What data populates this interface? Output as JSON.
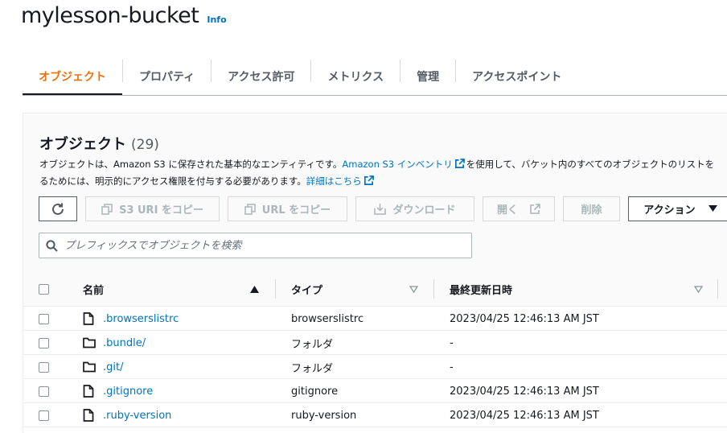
{
  "bucket": {
    "title": "mylesson-bucket",
    "info_label": "Info"
  },
  "tabs": [
    {
      "label": "オブジェクト"
    },
    {
      "label": "プロパティ"
    },
    {
      "label": "アクセス許可"
    },
    {
      "label": "メトリクス"
    },
    {
      "label": "管理"
    },
    {
      "label": "アクセスポイント"
    }
  ],
  "objects_panel": {
    "title": "オブジェクト",
    "count": "(29)",
    "description": {
      "part1": "オブジェクトは、Amazon S3 に保存された基本的なエンティティです。",
      "link1": "Amazon S3 インベントリ",
      "part2": "を使用して、バケット内のすべてのオブジェクトのリストを",
      "part3": "るためには、明示的にアクセス権限を付与する必要があります。",
      "link2": "詳細はこちら"
    }
  },
  "toolbar": {
    "copy_s3_uri": "S3 URI をコピー",
    "copy_url": "URL をコピー",
    "download": "ダウンロード",
    "open": "開く",
    "delete": "削除",
    "actions": "アクション"
  },
  "search": {
    "placeholder": "プレフィックスでオブジェクトを検索"
  },
  "table": {
    "headers": {
      "name": "名前",
      "type": "タイプ",
      "modified": "最終更新日時"
    },
    "rows": [
      {
        "name": ".browserslistrc",
        "type": "browserslistrc",
        "modified": "2023/04/25 12:46:13 AM JST",
        "icon": "file-icon"
      },
      {
        "name": ".bundle/",
        "type": "フォルダ",
        "modified": "-",
        "icon": "folder-icon"
      },
      {
        "name": ".git/",
        "type": "フォルダ",
        "modified": "-",
        "icon": "folder-icon"
      },
      {
        "name": ".gitignore",
        "type": "gitignore",
        "modified": "2023/04/25 12:46:13 AM JST",
        "icon": "file-icon"
      },
      {
        "name": ".ruby-version",
        "type": "ruby-version",
        "modified": "2023/04/25 12:46:13 AM JST",
        "icon": "file-icon"
      }
    ]
  },
  "colors": {
    "accent": "#ec7211",
    "link": "#0073bb",
    "text": "#16191f",
    "muted": "#aab7b8"
  }
}
